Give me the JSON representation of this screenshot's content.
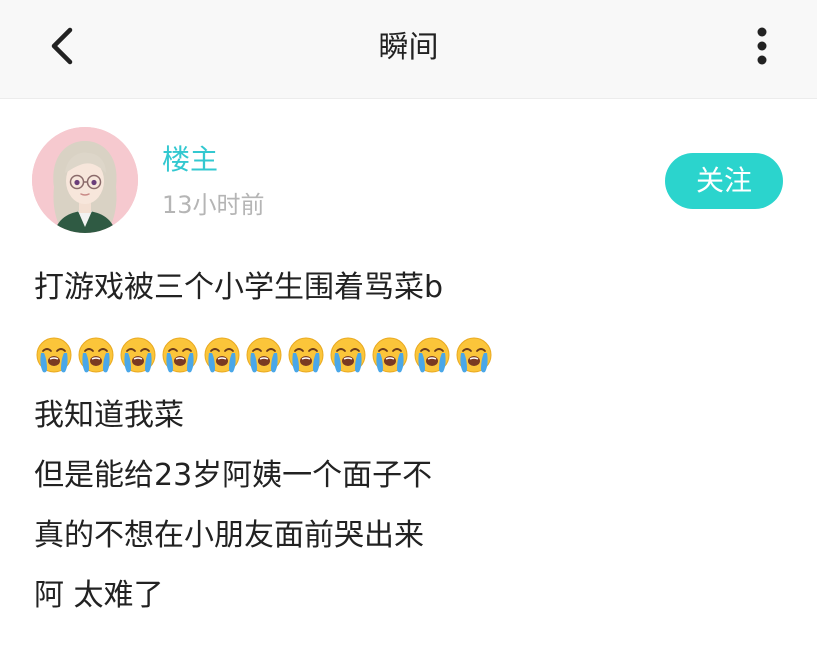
{
  "header": {
    "title": "瞬间",
    "back_icon": "chevron-left-icon",
    "more_icon": "vertical-ellipsis-icon"
  },
  "author": {
    "name": "楼主",
    "time": "13小时前",
    "avatar_icon": "avatar"
  },
  "follow": {
    "label": "关注"
  },
  "post": {
    "line1": "打游戏被三个小学生围着骂菜b",
    "emoji_icon": "loudly-crying-face-icon",
    "emoji_count": 11,
    "line2": "我知道我菜",
    "line3": "但是能给23岁阿姨一个面子不",
    "line4": "真的不想在小朋友面前哭出来",
    "line5": "阿 太难了"
  },
  "colors": {
    "accent": "#2bd4cd",
    "username": "#33c8d0",
    "timestamp": "#b5b5b5",
    "text": "#222222"
  }
}
